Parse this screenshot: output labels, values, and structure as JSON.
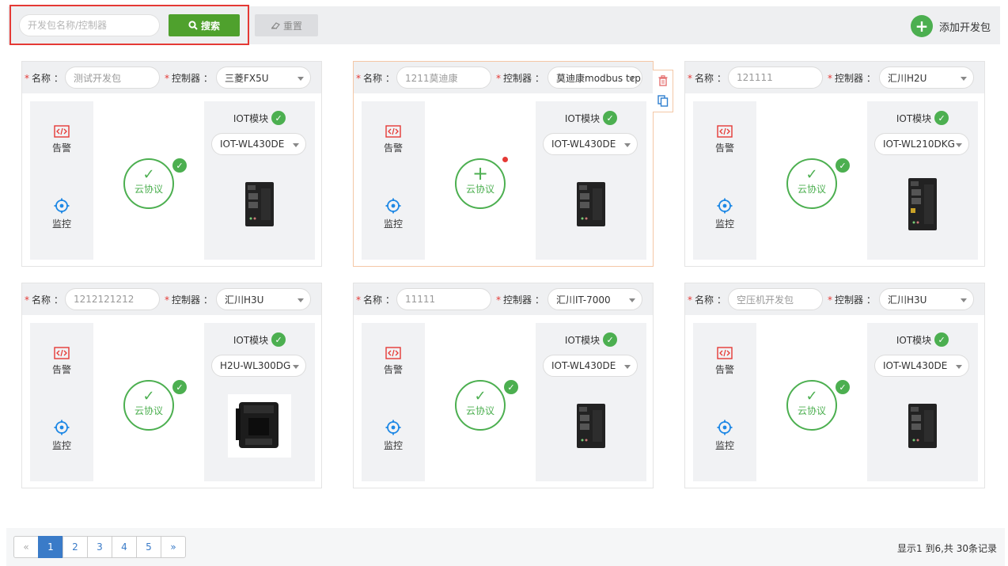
{
  "toolbar": {
    "search_placeholder": "开发包名称/控制器",
    "search_label": "搜索",
    "reset_label": "重置",
    "add_label": "添加开发包"
  },
  "labels": {
    "name": "名称 ：",
    "controller": "控制器 ：",
    "alarm": "告警",
    "monitor": "监控",
    "iot": "IOT模块",
    "cloud": "云协议"
  },
  "cards": [
    {
      "name": "测试开发包",
      "controller": "三菱FX5U",
      "iot_model": "IOT-WL430DE",
      "device": "dark",
      "cloud_state": "configured"
    },
    {
      "name": "1211莫迪康",
      "controller": "莫迪康modbus tcp",
      "iot_model": "IOT-WL430DE",
      "device": "dark",
      "cloud_state": "add"
    },
    {
      "name": "121111",
      "controller": "汇川H2U",
      "iot_model": "IOT-WL210DKG",
      "device": "dark-tall",
      "cloud_state": "configured"
    },
    {
      "name": "1212121212",
      "controller": "汇川H3U",
      "iot_model": "H2U-WL300DG",
      "device": "black-box",
      "cloud_state": "configured"
    },
    {
      "name": "11111",
      "controller": "汇川IT-7000",
      "iot_model": "IOT-WL430DE",
      "device": "dark",
      "cloud_state": "configured"
    },
    {
      "name": "空压机开发包",
      "controller": "汇川H3U",
      "iot_model": "IOT-WL430DE",
      "device": "dark",
      "cloud_state": "configured"
    }
  ],
  "pagination": {
    "prev": "«",
    "pages": [
      "1",
      "2",
      "3",
      "4",
      "5"
    ],
    "next": "»",
    "current": "1",
    "info": "显示1 到6,共 30条记录"
  },
  "colors": {
    "accent_green": "#4fa12d",
    "status_green": "#4caf50",
    "highlight_red": "#e53935",
    "page_blue": "#3a7bc8"
  }
}
